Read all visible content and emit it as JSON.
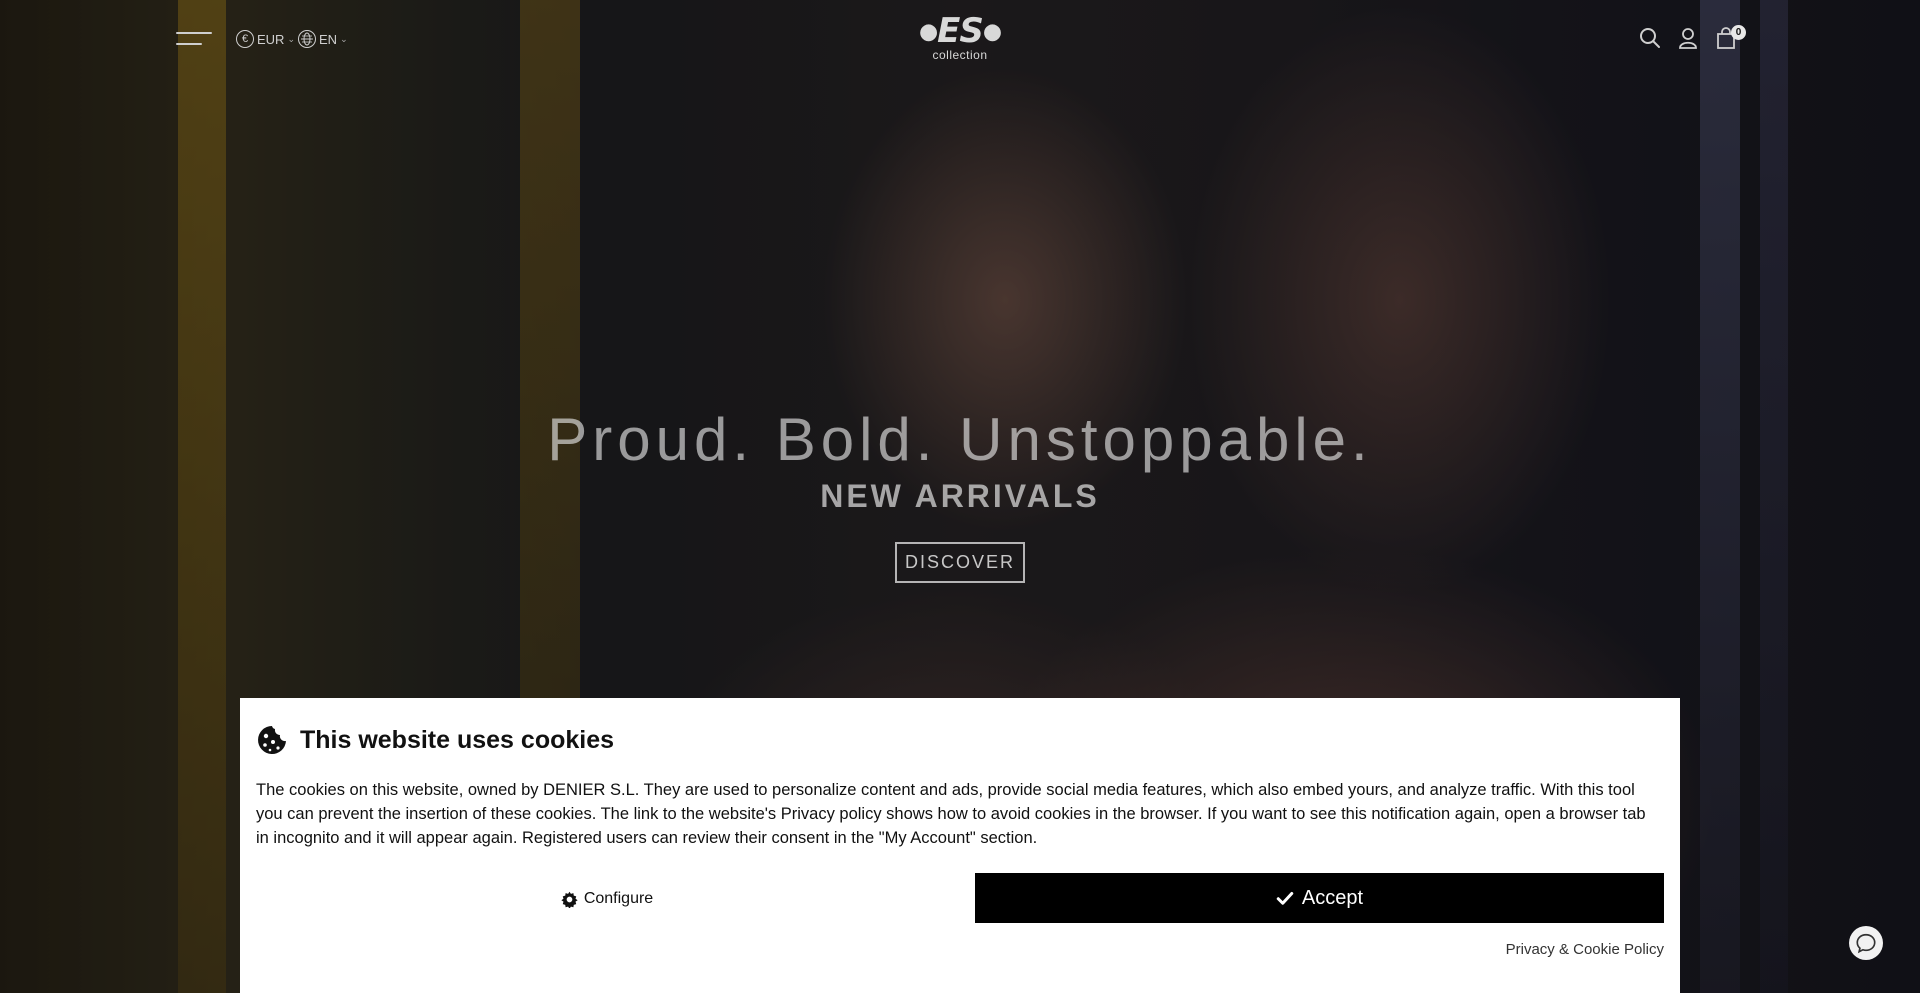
{
  "header": {
    "menu_icon": "hamburger-menu-icon",
    "currency": {
      "label": "EUR",
      "icon": "euro-icon",
      "icon_glyph": "€"
    },
    "language": {
      "label": "EN",
      "icon": "globe-icon"
    },
    "logo": {
      "mark": "ES",
      "sub": "collection"
    },
    "icons": [
      "search-icon",
      "user-icon",
      "shopping-bag-icon"
    ],
    "cart_count": "0"
  },
  "hero": {
    "tagline": "Proud. Bold. Unstoppable.",
    "subtitle": "NEW ARRIVALS",
    "cta": "DISCOVER"
  },
  "cookie_banner": {
    "icon": "cookie-icon",
    "title": "This website uses cookies",
    "text": "The cookies on this website, owned by DENIER S.L. They are used to personalize content and ads, provide social media features, which also embed yours, and analyze traffic. With this tool you can prevent the insertion of these cookies. The link to the website's Privacy policy shows how to avoid cookies in the browser. If you want to see this notification again, open a browser tab in incognito and it will appear again. Registered users can review their consent in the \"My Account\" section.",
    "configure_label": "Configure",
    "configure_icon": "gear-icon",
    "accept_label": "Accept",
    "accept_icon": "checkmark-icon",
    "privacy_link": "Privacy & Cookie Policy"
  },
  "chat": {
    "icon": "chat-bubble-icon"
  },
  "colors": {
    "banner_bg": "#ffffff",
    "accept_bg": "#000000",
    "header_text": "#cfcfcf"
  }
}
